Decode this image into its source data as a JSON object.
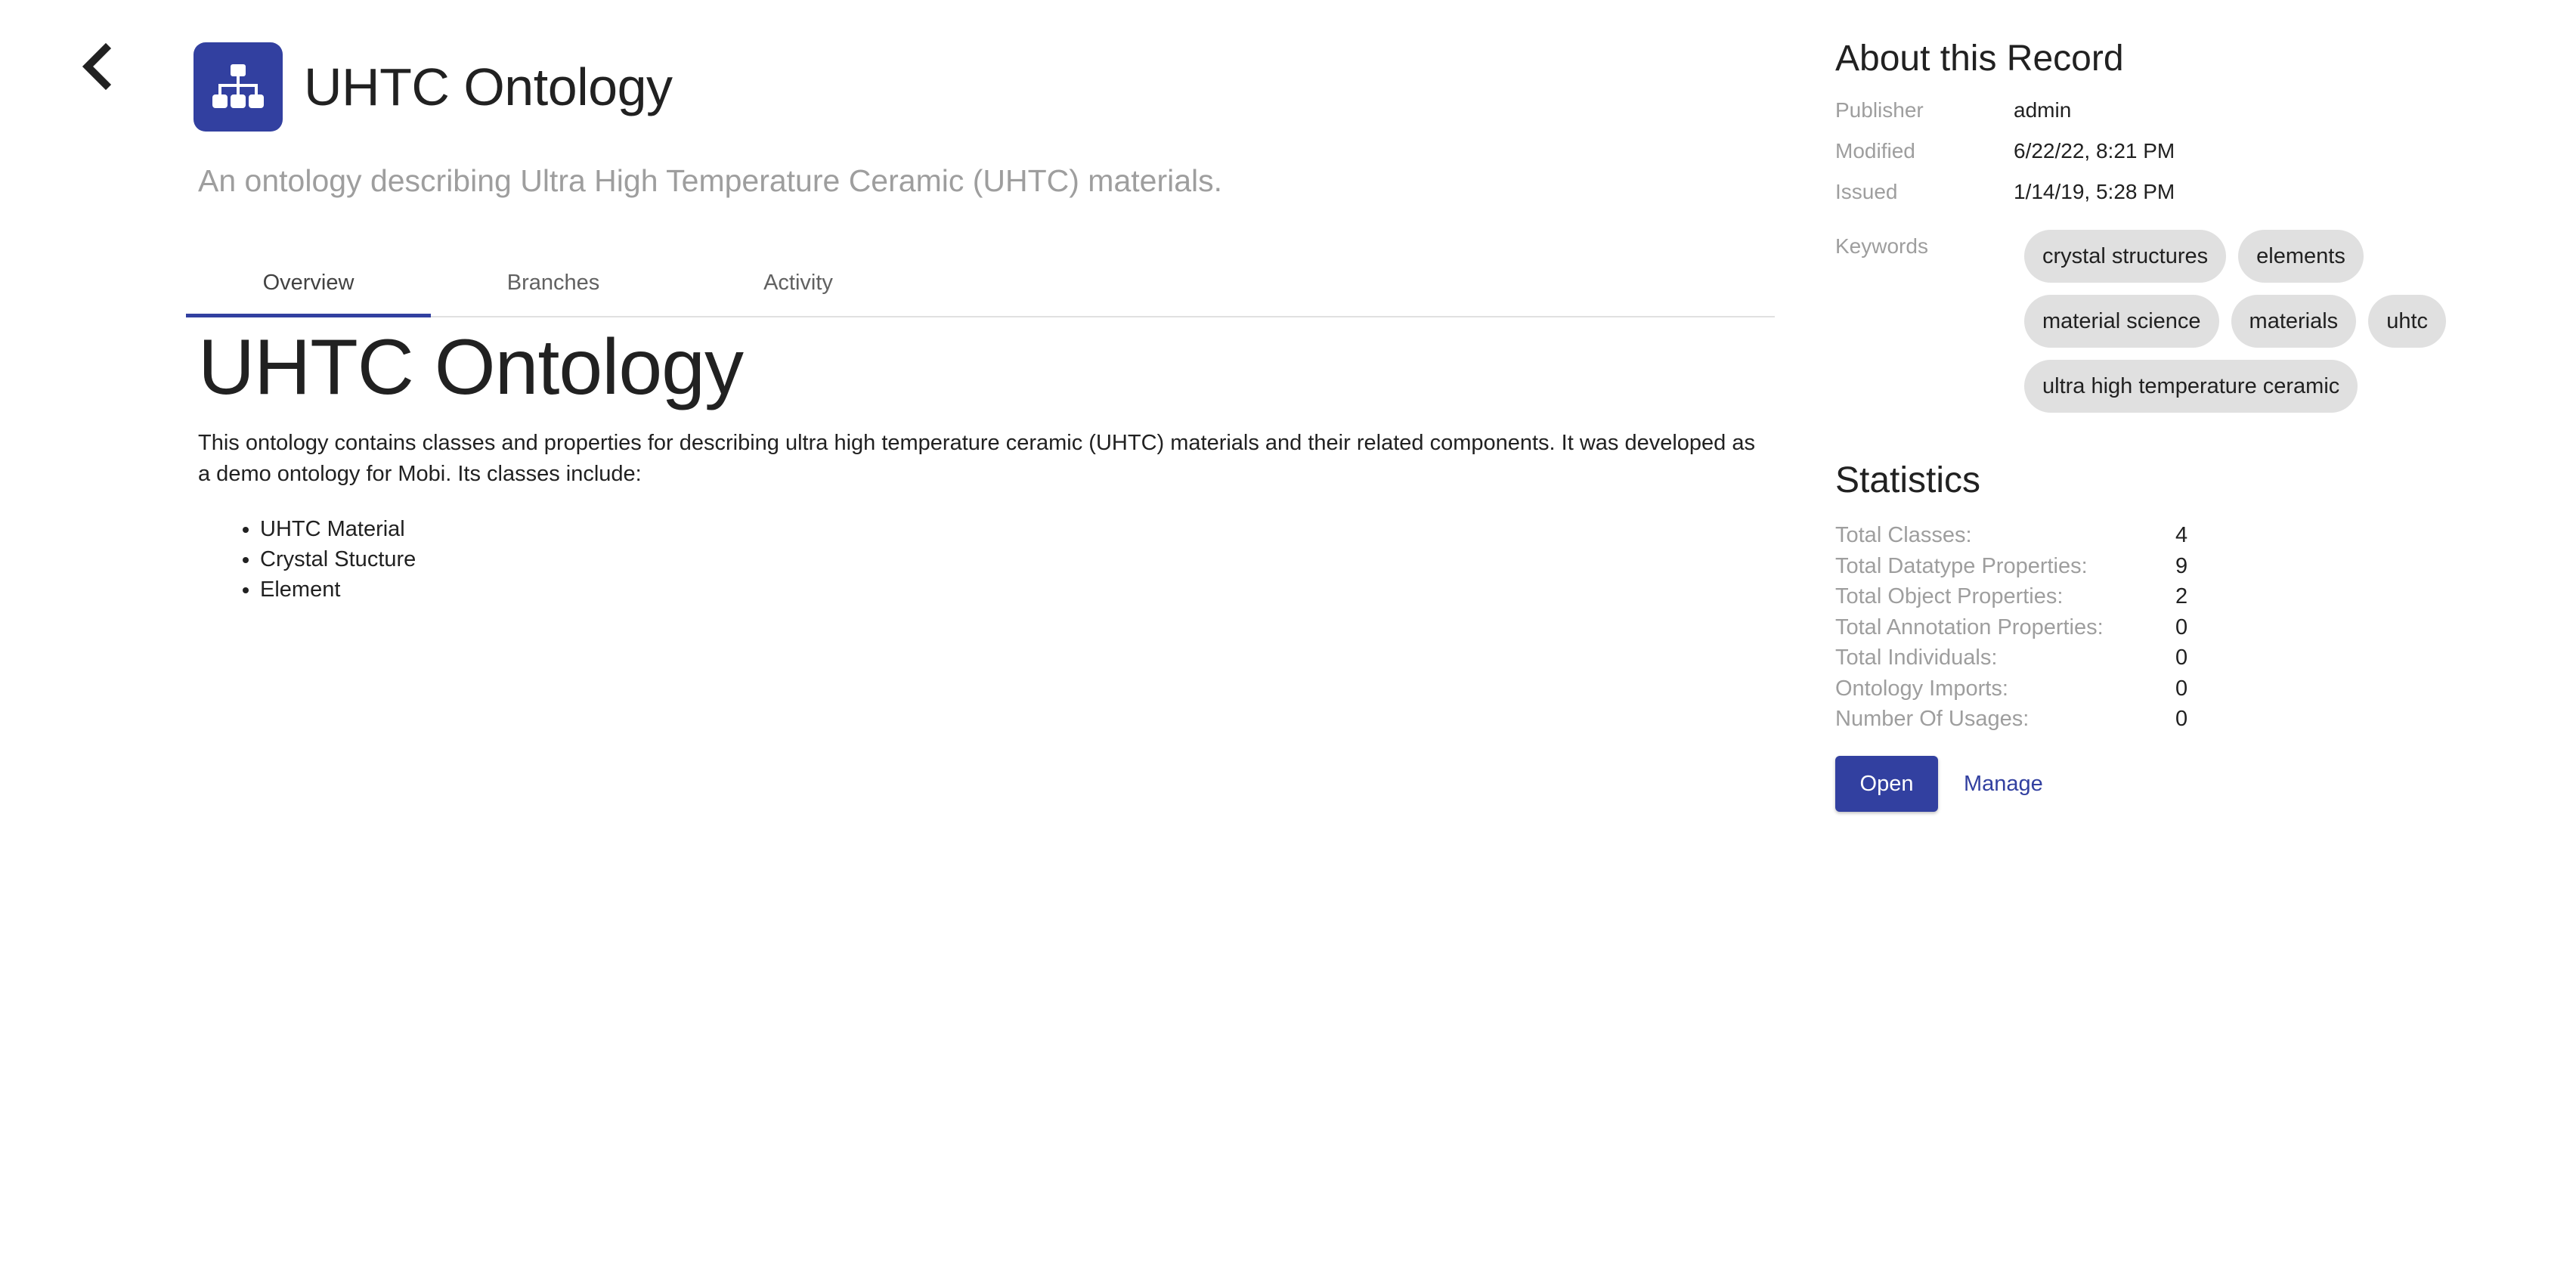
{
  "header": {
    "title": "UHTC Ontology",
    "description": "An ontology describing Ultra High Temperature Ceramic (UHTC) materials.",
    "icon": "sitemap-icon",
    "accent_color": "#3240a0"
  },
  "tabs": [
    {
      "label": "Overview",
      "active": true
    },
    {
      "label": "Branches",
      "active": false
    },
    {
      "label": "Activity",
      "active": false
    }
  ],
  "overview": {
    "heading": "UHTC Ontology",
    "paragraph": "This ontology contains classes and properties for describing ultra high temperature ceramic (UHTC) materials and their related components. It was developed as a demo ontology for Mobi. Its classes include:",
    "list": [
      "UHTC Material",
      "Crystal Stucture",
      "Element"
    ]
  },
  "about": {
    "title": "About this Record",
    "rows": [
      {
        "label": "Publisher",
        "value": "admin"
      },
      {
        "label": "Modified",
        "value": "6/22/22, 8:21 PM"
      },
      {
        "label": "Issued",
        "value": "1/14/19, 5:28 PM"
      }
    ],
    "keywords_label": "Keywords",
    "keywords": [
      "crystal structures",
      "elements",
      "material science",
      "materials",
      "uhtc",
      "ultra high temperature ceramic"
    ]
  },
  "statistics": {
    "title": "Statistics",
    "rows": [
      {
        "label": "Total Classes:",
        "value": "4"
      },
      {
        "label": "Total Datatype Properties:",
        "value": "9"
      },
      {
        "label": "Total Object Properties:",
        "value": "2"
      },
      {
        "label": "Total Annotation Properties:",
        "value": "0"
      },
      {
        "label": "Total Individuals:",
        "value": "0"
      },
      {
        "label": "Ontology Imports:",
        "value": "0"
      },
      {
        "label": "Number Of Usages:",
        "value": "0"
      }
    ]
  },
  "actions": {
    "open_label": "Open",
    "manage_label": "Manage"
  }
}
